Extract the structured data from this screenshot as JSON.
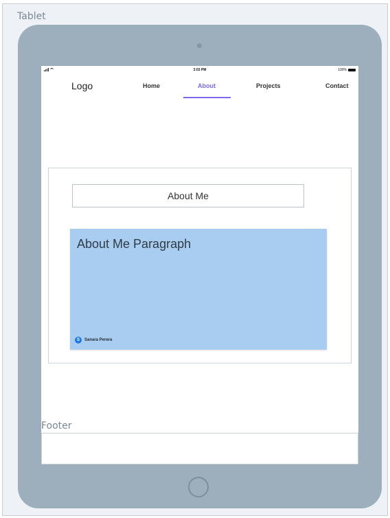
{
  "frame": {
    "label": "Tablet"
  },
  "status_bar": {
    "time": "3:03 PM",
    "battery": "100%"
  },
  "nav": {
    "logo": "Logo",
    "items": [
      {
        "label": "Home"
      },
      {
        "label": "About",
        "active": true
      },
      {
        "label": "Projects"
      },
      {
        "label": "Contact"
      }
    ]
  },
  "about": {
    "title": "About Me",
    "paragraph_heading": "About Me Paragraph",
    "author_initial": "S",
    "author_name": "Sanara Perera"
  },
  "footer": {
    "label": "Footer"
  },
  "colors": {
    "accent": "#7b68ee",
    "tablet_body": "#9daebd",
    "paragraph_bg": "#a9cdf0",
    "avatar": "#1e7be0"
  }
}
